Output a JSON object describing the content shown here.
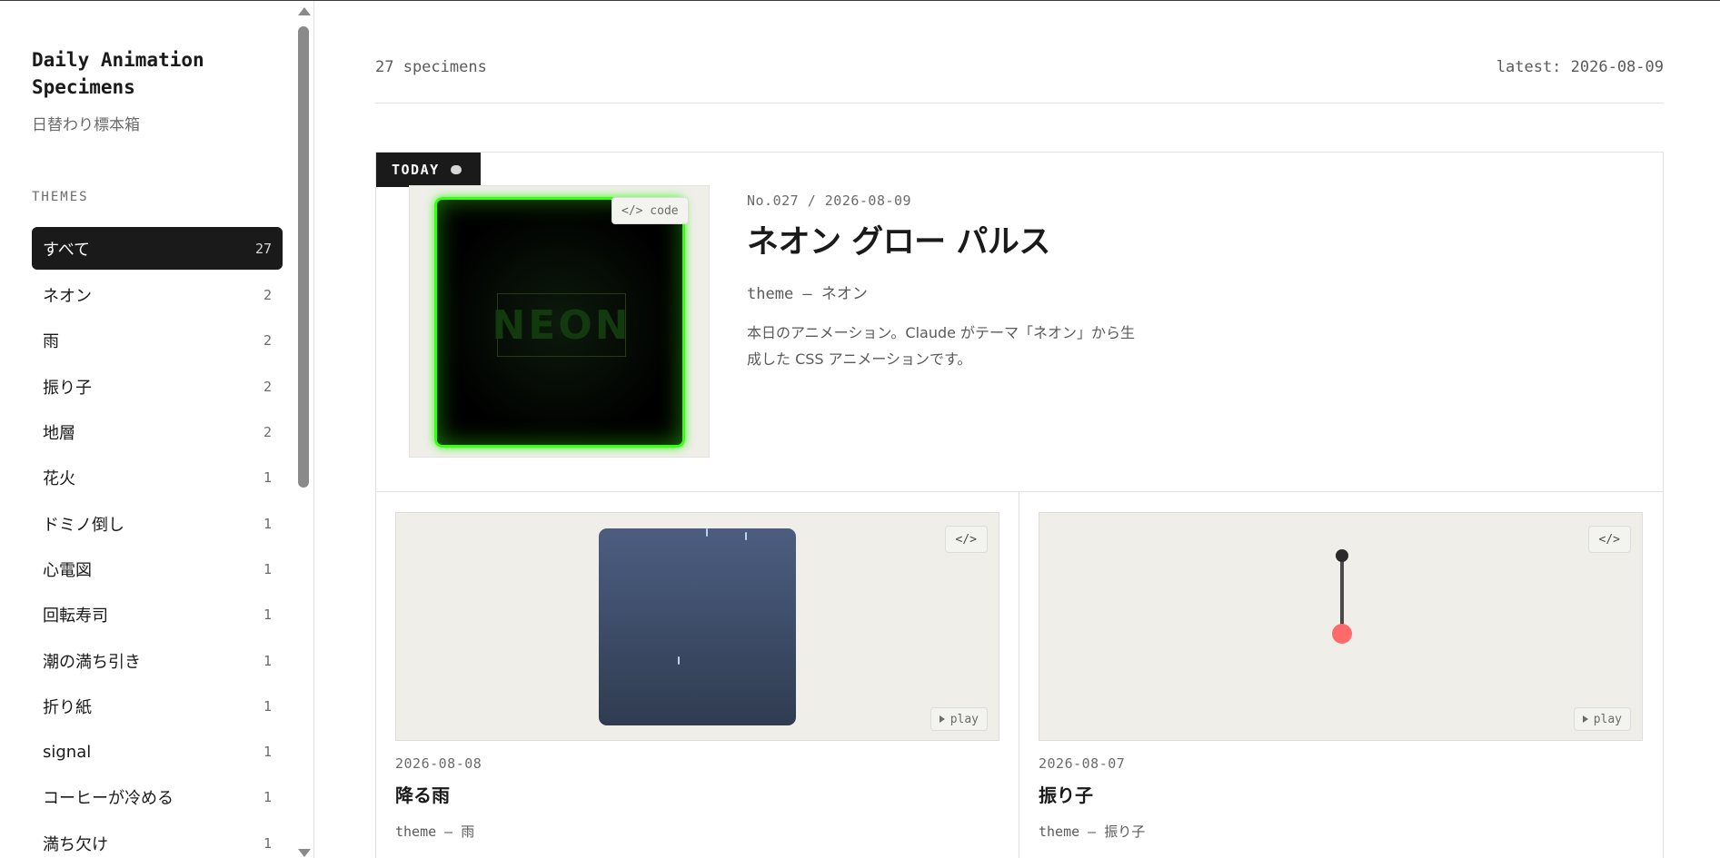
{
  "sidebar": {
    "title": "Daily Animation Specimens",
    "subtitle": "日替わり標本箱",
    "themes_label": "THEMES",
    "themes": [
      {
        "label": "すべて",
        "count": "27"
      },
      {
        "label": "ネオン",
        "count": "2"
      },
      {
        "label": "雨",
        "count": "2"
      },
      {
        "label": "振り子",
        "count": "2"
      },
      {
        "label": "地層",
        "count": "2"
      },
      {
        "label": "花火",
        "count": "1"
      },
      {
        "label": "ドミノ倒し",
        "count": "1"
      },
      {
        "label": "心電図",
        "count": "1"
      },
      {
        "label": "回転寿司",
        "count": "1"
      },
      {
        "label": "潮の満ち引き",
        "count": "1"
      },
      {
        "label": "折り紙",
        "count": "1"
      },
      {
        "label": "signal",
        "count": "1"
      },
      {
        "label": "コーヒーが冷める",
        "count": "1"
      },
      {
        "label": "満ち欠け",
        "count": "1"
      }
    ]
  },
  "header": {
    "count": "27 specimens",
    "latest": "latest: 2026-08-09"
  },
  "today": {
    "badge": "TODAY",
    "code_label": "</> code",
    "preview_text": "NEON",
    "date": "No.027 / 2026-08-09",
    "title": "ネオン グロー パルス",
    "theme": "theme — ネオン",
    "desc": "本日のアニメーション。Claude がテーマ「ネオン」から生成した CSS アニメーションです。",
    "accent_color": "#39ff14"
  },
  "cards": [
    {
      "date": "2026-08-08",
      "title": "降る雨",
      "theme": "theme — 雨",
      "code_label": "</>",
      "play_label": "play"
    },
    {
      "date": "2026-08-07",
      "title": "振り子",
      "theme": "theme — 振り子",
      "code_label": "</>",
      "play_label": "play"
    }
  ],
  "colors": {
    "rain_top": "#4c5d80",
    "rain_bottom": "#2f3c51",
    "pendulum_bob": "#ff6b6b"
  },
  "icons": {
    "today_dot": "dot-icon",
    "play": "play-icon",
    "scroll_up": "chevron-up-icon",
    "scroll_down": "chevron-down-icon"
  }
}
